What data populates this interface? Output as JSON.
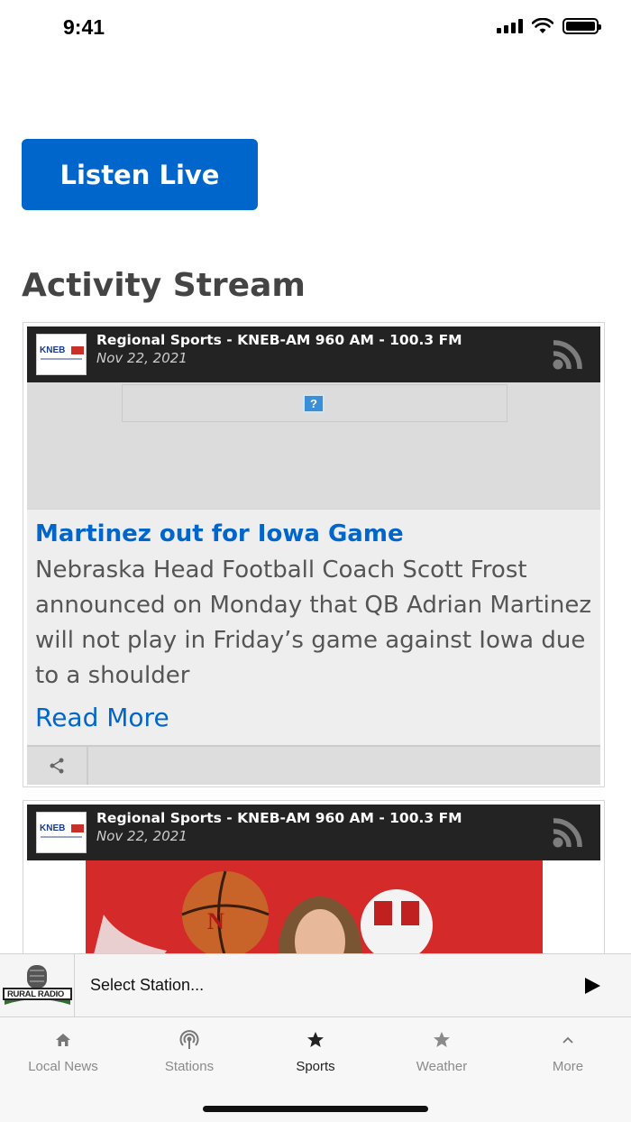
{
  "status": {
    "time": "9:41"
  },
  "listen_live": {
    "label": "Listen Live"
  },
  "section_title": "Activity Stream",
  "cards": [
    {
      "source": "Regional Sports - KNEB-AM 960 AM - 100.3 FM",
      "date": "Nov 22, 2021",
      "logo_text": "KNEB",
      "broken_image_glyph": "?",
      "headline": "Martinez out for Iowa Game",
      "excerpt": "Nebraska Head Football Coach Scott Frost announced on Monday that QB Adrian Martinez will not play in Friday’s game against Iowa due to a shoulder",
      "read_more": "Read More"
    },
    {
      "source": "Regional Sports - KNEB-AM 960 AM - 100.3 FM",
      "date": "Nov 22, 2021",
      "logo_text": "KNEB"
    }
  ],
  "player": {
    "station_placeholder": "Select Station...",
    "logo_text": "RURAL RADIO"
  },
  "tabs": [
    {
      "label": "Local News",
      "icon": "home-icon"
    },
    {
      "label": "Stations",
      "icon": "broadcast-icon"
    },
    {
      "label": "Sports",
      "icon": "star-icon",
      "active": true
    },
    {
      "label": "Weather",
      "icon": "star-icon"
    },
    {
      "label": "More",
      "icon": "chevron-up-icon"
    }
  ],
  "colors": {
    "accent": "#0066cc",
    "header_dark": "#232323",
    "card_body": "#eeeeee"
  }
}
